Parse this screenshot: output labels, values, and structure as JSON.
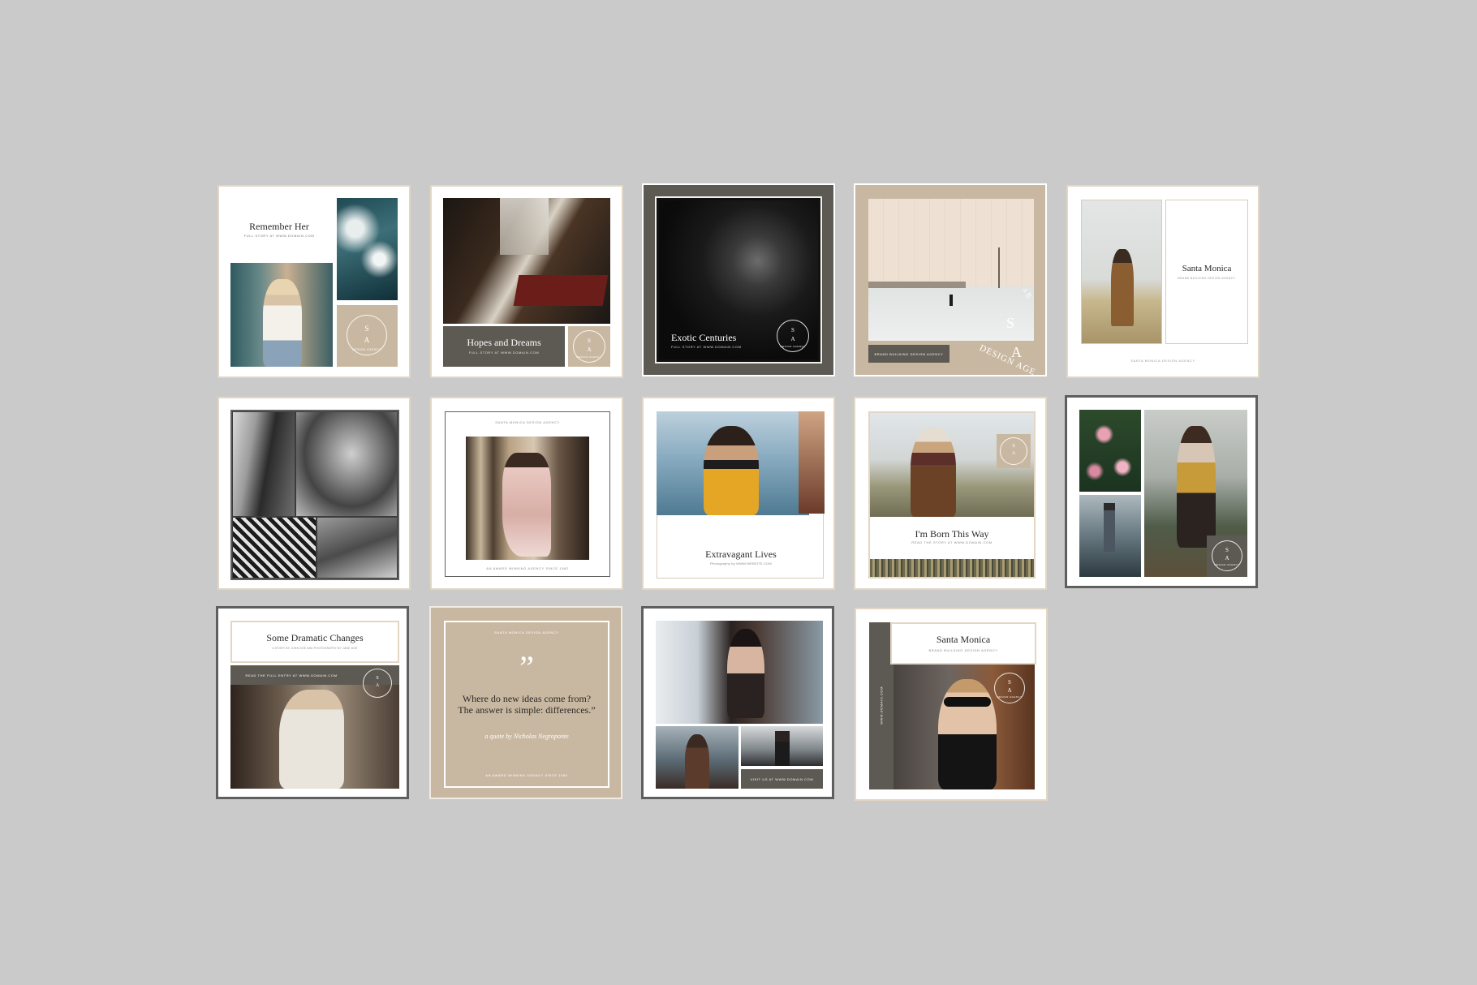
{
  "colors": {
    "background": "#cacaca",
    "taupe": "#c9b8a1",
    "charcoal": "#5d5953",
    "beige_border": "#e3d6c4",
    "dark_border": "#5f5f5f"
  },
  "seal": {
    "s": "S",
    "a": "A",
    "ring": "DESIGN AGENCY",
    "arc_text": "DESIGN AGE",
    "arc_top": "a B"
  },
  "cards": {
    "c1": {
      "title": "Remember Her",
      "sub": "FULL STORY AT WWW.DOMAIN.COM"
    },
    "c2": {
      "title": "Hopes and Dreams",
      "sub": "FULL STORY AT WWW.DOMAIN.COM"
    },
    "c3": {
      "title": "Exotic Centuries",
      "sub": "FULL STORY AT WWW.DOMAIN.COM"
    },
    "c4": {
      "band": "BRAND BUILDING DESIGN AGENCY"
    },
    "c5": {
      "title": "Santa Monica",
      "sub": "BRAND BUILDING DESIGN AGENCY",
      "footer": "SANTA MONICA DESIGN AGENCY"
    },
    "c7": {
      "top": "SANTA MONICA DESIGN AGENCY",
      "bottom": "AN AWARD WINNING AGENCY SINCE 1982"
    },
    "c8": {
      "title": "Extravagant Lives",
      "sub": "Photography by WWW.WEBSITE.COM"
    },
    "c9": {
      "title": "I'm Born This Way",
      "sub": "READ THE STORY AT WWW.DOMAIN.COM"
    },
    "c11": {
      "title": "Some Dramatic Changes",
      "sub": "A STORY BY JOHN DOE AND PHOTOGRAPHY BY JANE DOE",
      "band": "READ THE FULL ENTRY AT WWW.DOMAIN.COM"
    },
    "c12": {
      "top": "SANTA MONICA DESIGN AGENCY",
      "quote_mark": "”",
      "line1": "Where do new ideas come from?",
      "line2": "The answer is simple: differences.”",
      "attribution": "a quote by Nicholas Negroponte",
      "bottom": "AN AWARD WINNING AGENCY SINCE 1982"
    },
    "c13": {
      "band": "VISIT US AT WWW.DOMAIN.COM"
    },
    "c14": {
      "title": "Santa Monica",
      "sub": "BRAND BUILDING DESIGN AGENCY",
      "vertical": "WWW.DOMAIN.COM"
    }
  }
}
